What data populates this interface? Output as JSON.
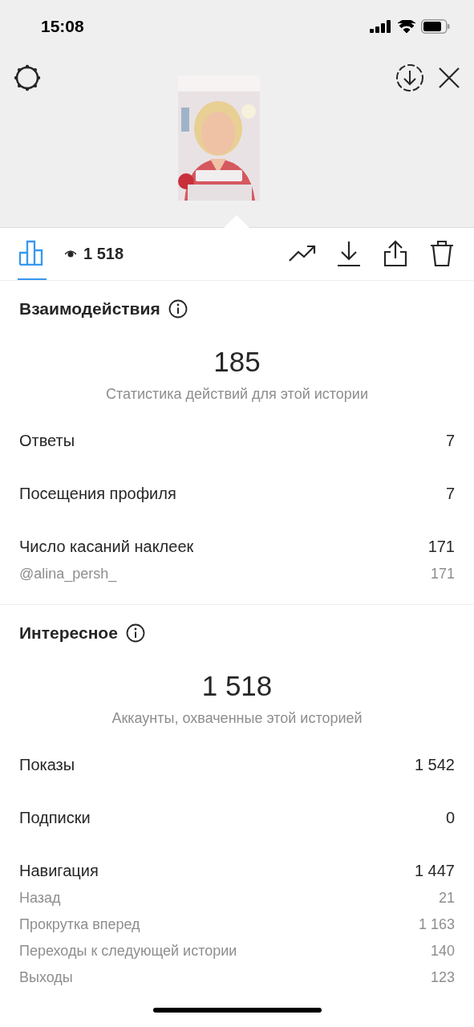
{
  "status_bar": {
    "time": "15:08"
  },
  "toolbar": {
    "stats_tab": {
      "selected": true
    },
    "views": "1 518"
  },
  "sections": [
    {
      "title": "Взаимодействия",
      "total": "185",
      "caption": "Статистика действий для этой истории",
      "rows": [
        {
          "kind": "main",
          "label": "Ответы",
          "value": "7"
        },
        {
          "kind": "main",
          "label": "Посещения профиля",
          "value": "7"
        },
        {
          "kind": "main",
          "label": "Число касаний наклеек",
          "value": "171"
        },
        {
          "kind": "sub",
          "label": "@alina_persh_",
          "value": "171"
        }
      ]
    },
    {
      "title": "Интересное",
      "total": "1 518",
      "caption": "Аккаунты, охваченные этой историей",
      "rows": [
        {
          "kind": "main",
          "label": "Показы",
          "value": "1 542"
        },
        {
          "kind": "main",
          "label": "Подписки",
          "value": "0"
        },
        {
          "kind": "main",
          "label": "Навигация",
          "value": "1 447"
        },
        {
          "kind": "sub",
          "label": "Назад",
          "value": "21"
        },
        {
          "kind": "sub",
          "label": "Прокрутка вперед",
          "value": "1 163"
        },
        {
          "kind": "sub",
          "label": "Переходы к следующей истории",
          "value": "140"
        },
        {
          "kind": "sub",
          "label": "Выходы",
          "value": "123"
        }
      ]
    }
  ]
}
